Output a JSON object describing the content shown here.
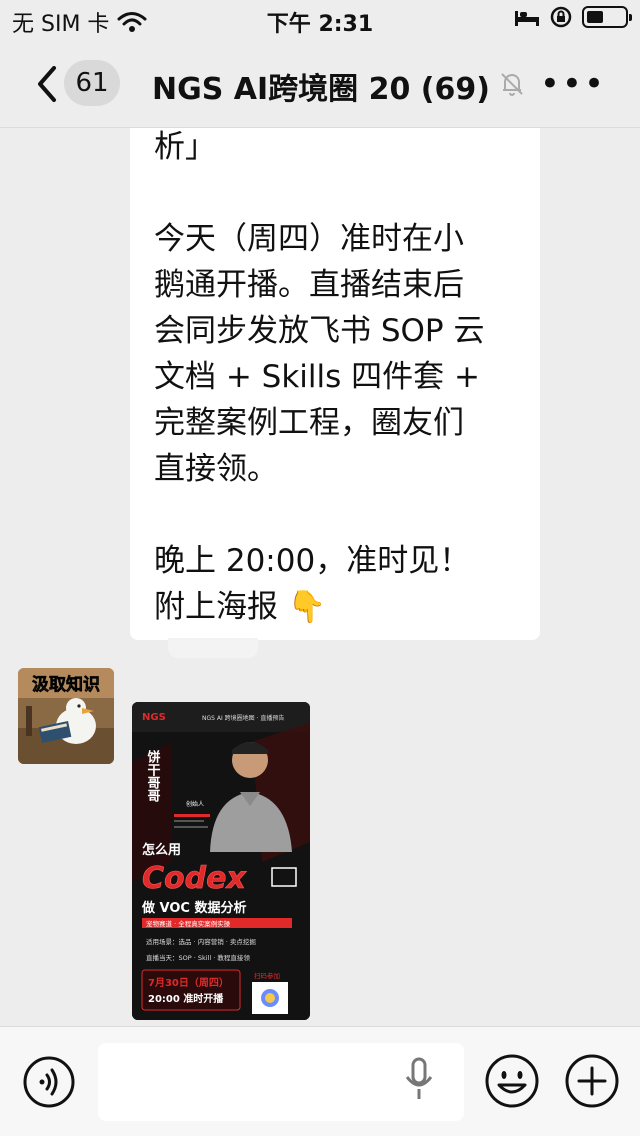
{
  "status_bar": {
    "carrier": "无 SIM 卡",
    "time": "下午 2:31",
    "battery_level": 0.45
  },
  "nav": {
    "unread_count": "61",
    "title": "NGS AI跨境圈 20 (69)"
  },
  "messages": [
    {
      "type": "text",
      "lines": [
        "析」",
        "",
        "今天（周四）准时在小",
        "鹅通开播。直播结束后",
        "会同步发放飞书 SOP 云",
        "文档 + Skills 四件套 +",
        "完整案例工程，圈友们",
        "直接领。",
        "",
        "晚上 20:00，准时见！",
        "附上海报 👇"
      ]
    }
  ],
  "sender_avatar": {
    "caption": "汲取知识"
  },
  "poster": {
    "brand": "NGS",
    "header": "NGS AI 跨境圈地图 · 直播预告",
    "side_name": "饼干哥哥",
    "founder_tag": "创始人",
    "headline_1": "怎么用",
    "headline_2": "Codex",
    "headline_3": "做 VOC 数据分析",
    "sub_banner": "宠物赛道 · 全程真实案例实操",
    "scene_line": "适用场景：选品 · 内容营销 · 卖点挖掘",
    "benefit_line": "直播当天：SOP · Skill · 教程直接领",
    "date": "7月30日（周四）",
    "time": "20:00 准时开播",
    "qr_label": "扫码参加"
  },
  "colors": {
    "background": "#ededed",
    "bubble": "#ffffff",
    "poster_red": "#e02a2a",
    "poster_bg": "#121212"
  },
  "icons": [
    "back-chevron-icon",
    "mute-bell-icon",
    "more-dots-icon",
    "voice-icon",
    "mic-icon",
    "emoji-icon",
    "plus-icon",
    "wifi-icon",
    "bed-icon",
    "rotation-lock-icon"
  ]
}
